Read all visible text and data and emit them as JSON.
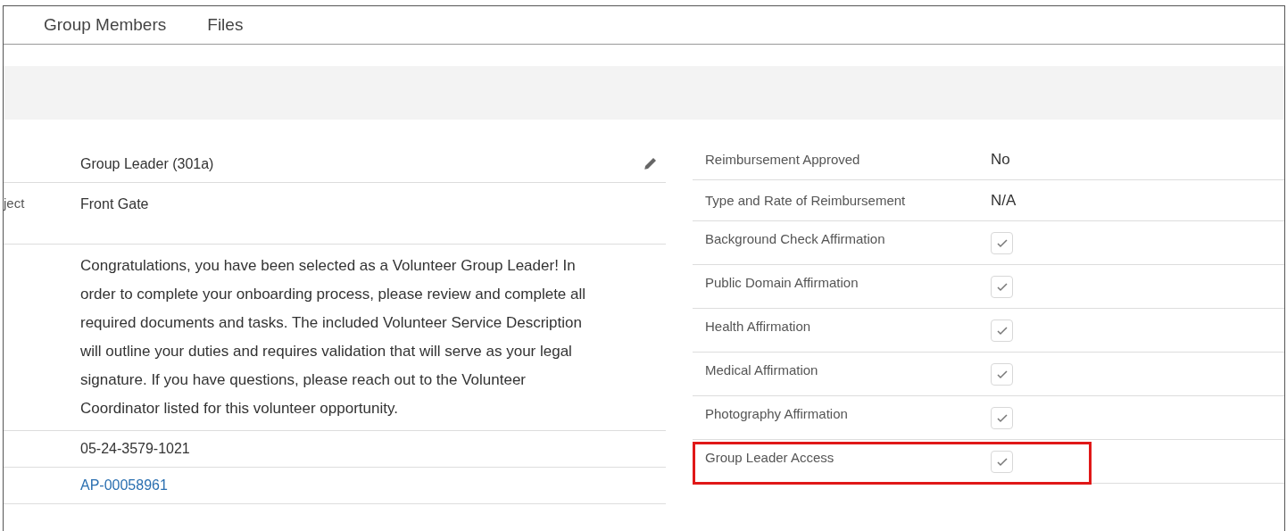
{
  "tabs": [
    {
      "label": "Group Members"
    },
    {
      "label": "Files"
    }
  ],
  "left_fields": [
    {
      "kind": "text",
      "value": "Group Leader (301a)",
      "editable": true
    },
    {
      "kind": "text",
      "label": "ject",
      "value": "Front Gate"
    },
    {
      "kind": "paragraph",
      "value": "Congratulations, you have been selected as a Volunteer Group Leader! In order to complete your onboarding process, please review and complete all required documents and tasks. The included Volunteer Service Description will outline your duties and requires validation that will serve as your legal signature. If you have questions, please reach out to the Volunteer Coordinator listed for this volunteer opportunity."
    },
    {
      "kind": "text",
      "value": "05-24-3579-1021"
    },
    {
      "kind": "link",
      "value": "AP-00058961"
    }
  ],
  "right_fields": [
    {
      "kind": "text",
      "label": "Reimbursement Approved",
      "value": "No",
      "highlighted": false
    },
    {
      "kind": "text",
      "label": "Type and Rate of Reimbursement",
      "value": "N/A",
      "highlighted": false
    },
    {
      "kind": "checkbox",
      "label": "Background Check Affirmation",
      "checked": true,
      "highlighted": false
    },
    {
      "kind": "checkbox",
      "label": "Public Domain Affirmation",
      "checked": true,
      "highlighted": false
    },
    {
      "kind": "checkbox",
      "label": "Health Affirmation",
      "checked": true,
      "highlighted": false
    },
    {
      "kind": "checkbox",
      "label": "Medical Affirmation",
      "checked": true,
      "highlighted": false
    },
    {
      "kind": "checkbox",
      "label": "Photography Affirmation",
      "checked": true,
      "highlighted": false
    },
    {
      "kind": "checkbox",
      "label": "Group Leader Access",
      "checked": true,
      "highlighted": true
    }
  ]
}
